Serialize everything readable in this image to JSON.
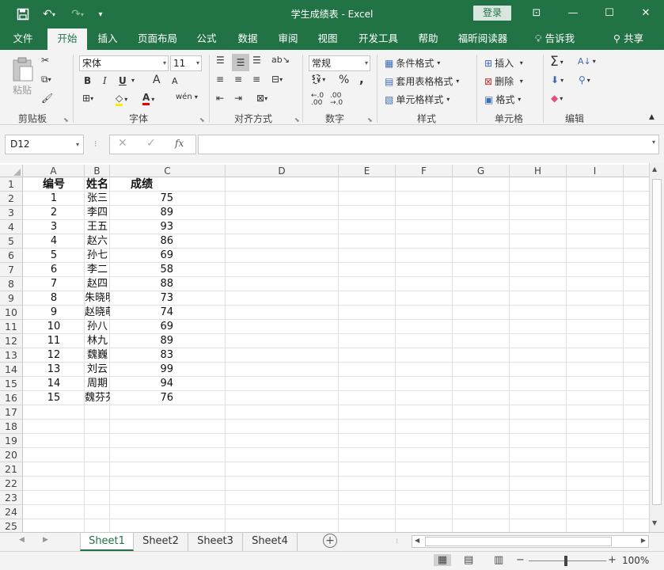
{
  "app": {
    "title": "学生成绩表  -  Excel",
    "login_label": "登录",
    "minimize_glyph": "—",
    "restore_glyph": "☐",
    "close_glyph": "✕",
    "ribbon_display_glyph": "⊡"
  },
  "ribbon_tabs": [
    "文件",
    "开始",
    "插入",
    "页面布局",
    "公式",
    "数据",
    "审阅",
    "视图",
    "开发工具",
    "帮助",
    "福昕阅读器"
  ],
  "tell_me": "告诉我",
  "share": "共享",
  "ribbon": {
    "clipboard": {
      "paste": "粘贴",
      "label": "剪贴板"
    },
    "font": {
      "name": "宋体",
      "size": "11",
      "label": "字体",
      "bold": "B",
      "italic": "I",
      "underline": "U",
      "grow": "A",
      "shrink": "A",
      "phonetic": "wén"
    },
    "alignment": {
      "label": "对齐方式"
    },
    "number": {
      "format": "常规",
      "label": "数字",
      "percent": "%",
      "comma": ","
    },
    "styles": {
      "conditional": "条件格式",
      "table": "套用表格格式",
      "cell": "单元格样式",
      "label": "样式"
    },
    "cells": {
      "insert": "插入",
      "delete": "删除",
      "format": "格式",
      "label": "单元格"
    },
    "editing": {
      "label": "编辑"
    }
  },
  "formula_bar": {
    "name_box": "D12",
    "fx": "fx",
    "value": ""
  },
  "columns": [
    "A",
    "B",
    "C",
    "D",
    "E",
    "F",
    "G",
    "H",
    "I"
  ],
  "rows": [
    "1",
    "2",
    "3",
    "4",
    "5",
    "6",
    "7",
    "8",
    "9",
    "10",
    "11",
    "12",
    "13",
    "14",
    "15",
    "16",
    "17",
    "18",
    "19",
    "20",
    "21",
    "22",
    "23",
    "24",
    "25"
  ],
  "sheet": {
    "headers": [
      "编号",
      "姓名",
      "成绩"
    ],
    "records": [
      [
        "1",
        "张三",
        "75"
      ],
      [
        "2",
        "李四",
        "89"
      ],
      [
        "3",
        "王五",
        "93"
      ],
      [
        "4",
        "赵六",
        "86"
      ],
      [
        "5",
        "孙七",
        "69"
      ],
      [
        "6",
        "李二",
        "58"
      ],
      [
        "7",
        "赵四",
        "88"
      ],
      [
        "8",
        "朱晓明",
        "73"
      ],
      [
        "9",
        "赵晓萌",
        "74"
      ],
      [
        "10",
        "孙八",
        "69"
      ],
      [
        "11",
        "林九",
        "89"
      ],
      [
        "12",
        "魏巍",
        "83"
      ],
      [
        "13",
        "刘云",
        "99"
      ],
      [
        "14",
        "周期",
        "94"
      ],
      [
        "15",
        "魏芬芬",
        "76"
      ]
    ]
  },
  "sheet_tabs": [
    "Sheet1",
    "Sheet2",
    "Sheet3",
    "Sheet4"
  ],
  "active_sheet": "Sheet1",
  "add_sheet": "+",
  "zoom": "100%",
  "colors": {
    "accent": "#217346"
  }
}
